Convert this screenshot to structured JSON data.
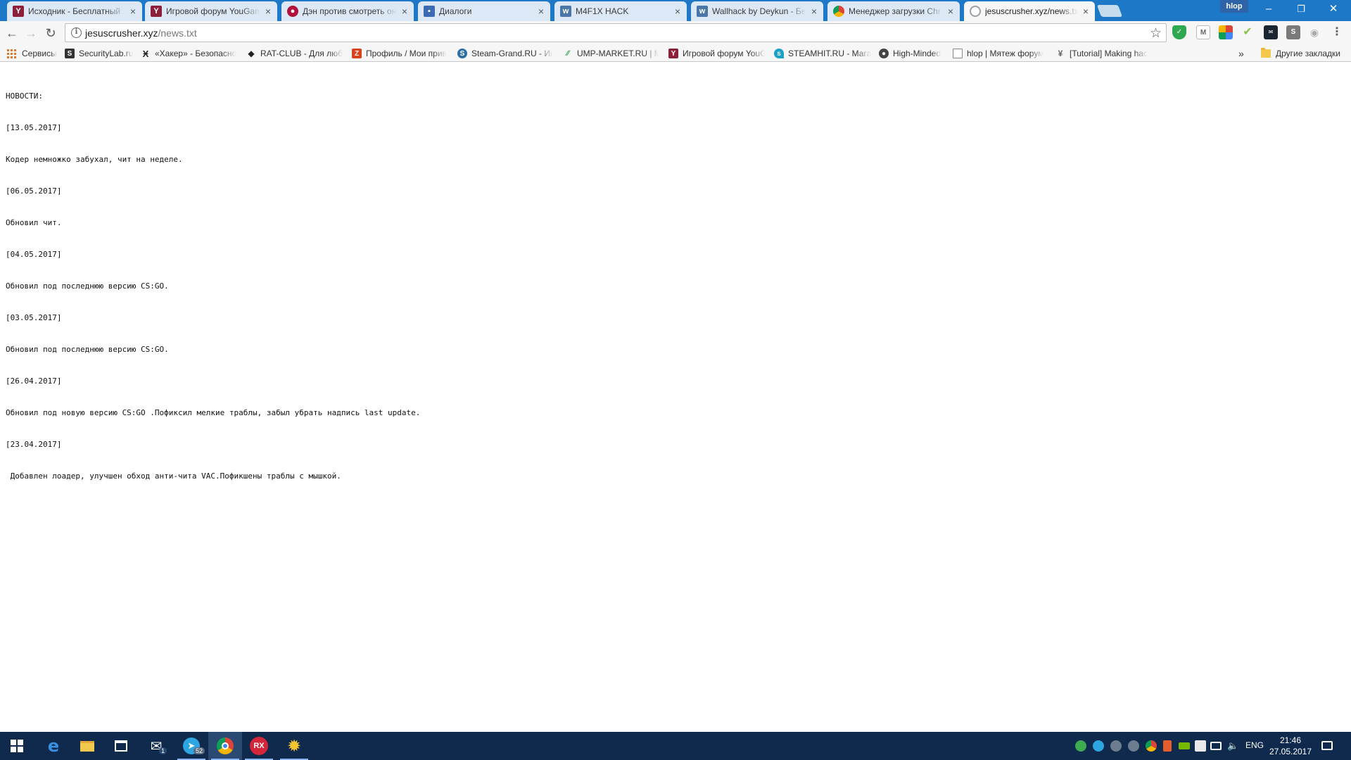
{
  "tabs": [
    {
      "title": "Исходник - Бесплатный",
      "icon": "yougame-icon",
      "color": "#8c1f3a"
    },
    {
      "title": "Игровой форум YouGame",
      "icon": "yougame-icon",
      "color": "#8c1f3a"
    },
    {
      "title": "Дэн против смотреть он",
      "icon": "video-site-icon",
      "color": "#b0123a"
    },
    {
      "title": "Диалоги",
      "icon": "messages-icon",
      "color": "#3d6bb3"
    },
    {
      "title": "M4F1X HACK",
      "icon": "vk-icon",
      "color": "#4a76a8"
    },
    {
      "title": "Wallhack by Deykun - Бе",
      "icon": "vk-icon",
      "color": "#4a76a8"
    },
    {
      "title": "Менеджер загрузки Chr",
      "icon": "chrome-icon",
      "color": "#4285f4"
    },
    {
      "title": "jesuscrusher.xyz/news.txt",
      "icon": "globe-icon",
      "color": "#9aa0a6"
    }
  ],
  "active_tab_index": 7,
  "profile_name": "hlop",
  "window_controls": {
    "minimize": "–",
    "restore": "❐",
    "close": "✕"
  },
  "address_bar": {
    "host": "jesuscrusher.xyz",
    "path": "/news.txt"
  },
  "bookmarks": [
    {
      "label": "Сервисы",
      "icon": "apps-grid-icon",
      "color": "#e0782e"
    },
    {
      "label": "SecurityLab.ru",
      "icon": "securitylab-icon",
      "color": "#333333"
    },
    {
      "label": "«Хакер» - Безопасно",
      "icon": "xakep-icon",
      "color": "#222222"
    },
    {
      "label": "RAT-CLUB - Для любо",
      "icon": "ratclub-icon",
      "color": "#222222"
    },
    {
      "label": "Профиль / Мои прив",
      "icon": "zhost-icon",
      "color": "#d9421c"
    },
    {
      "label": "Steam-Grand.RU - Ин",
      "icon": "steamgrand-icon",
      "color": "#2d6ea3"
    },
    {
      "label": "UMP-MARKET.RU | M",
      "icon": "ump-icon",
      "color": "#33a852"
    },
    {
      "label": "Игровой форум YouG",
      "icon": "yougame-icon",
      "color": "#8c1f3a"
    },
    {
      "label": "STEAMHIT.RU - Мага",
      "icon": "steamhit-icon",
      "color": "#1ba0c7"
    },
    {
      "label": "High-Minded",
      "icon": "highminded-icon",
      "color": "#444444"
    },
    {
      "label": "hlop | Мятеж форум",
      "icon": "page-icon",
      "color": "#777777"
    },
    {
      "label": "[Tutorial] Making hac",
      "icon": "tutorial-icon",
      "color": "#666666"
    }
  ],
  "bookmarks_overflow": "»",
  "other_bookmarks": "Другие закладки",
  "news_lines": [
    "НОВОСТИ:",
    "[13.05.2017]",
    "Кодер немножко забухал, чит на неделе.",
    "[06.05.2017]",
    "Обновил чит.",
    "[04.05.2017]",
    "Обновил под последнюю версию CS:GO.",
    "[03.05.2017]",
    "Обновил под последнюю версию CS:GO.",
    "[26.04.2017]",
    "Обновил под новую версию CS:GO .Пофиксил мелкие траблы, забыл убрать надпись last update.",
    "[23.04.2017]",
    " Добавлен лоадер, улучшен обход анти-чита VAC.Пофикшены траблы с мышкой."
  ],
  "taskbar": {
    "apps": [
      {
        "name": "start-button",
        "icon": "windows-icon"
      },
      {
        "name": "edge",
        "icon": "edge-icon"
      },
      {
        "name": "file-explorer",
        "icon": "folder-icon"
      },
      {
        "name": "store",
        "icon": "store-icon"
      },
      {
        "name": "mail",
        "icon": "mail-icon",
        "badge": "1"
      },
      {
        "name": "telegram",
        "icon": "telegram-icon",
        "badge": "52"
      },
      {
        "name": "chrome",
        "icon": "chrome-icon"
      },
      {
        "name": "rx",
        "icon": "rx-icon",
        "label": "RX"
      },
      {
        "name": "settings",
        "icon": "gear-icon"
      }
    ],
    "lang": "ENG",
    "time": "21:46",
    "date": "27.05.2017"
  }
}
